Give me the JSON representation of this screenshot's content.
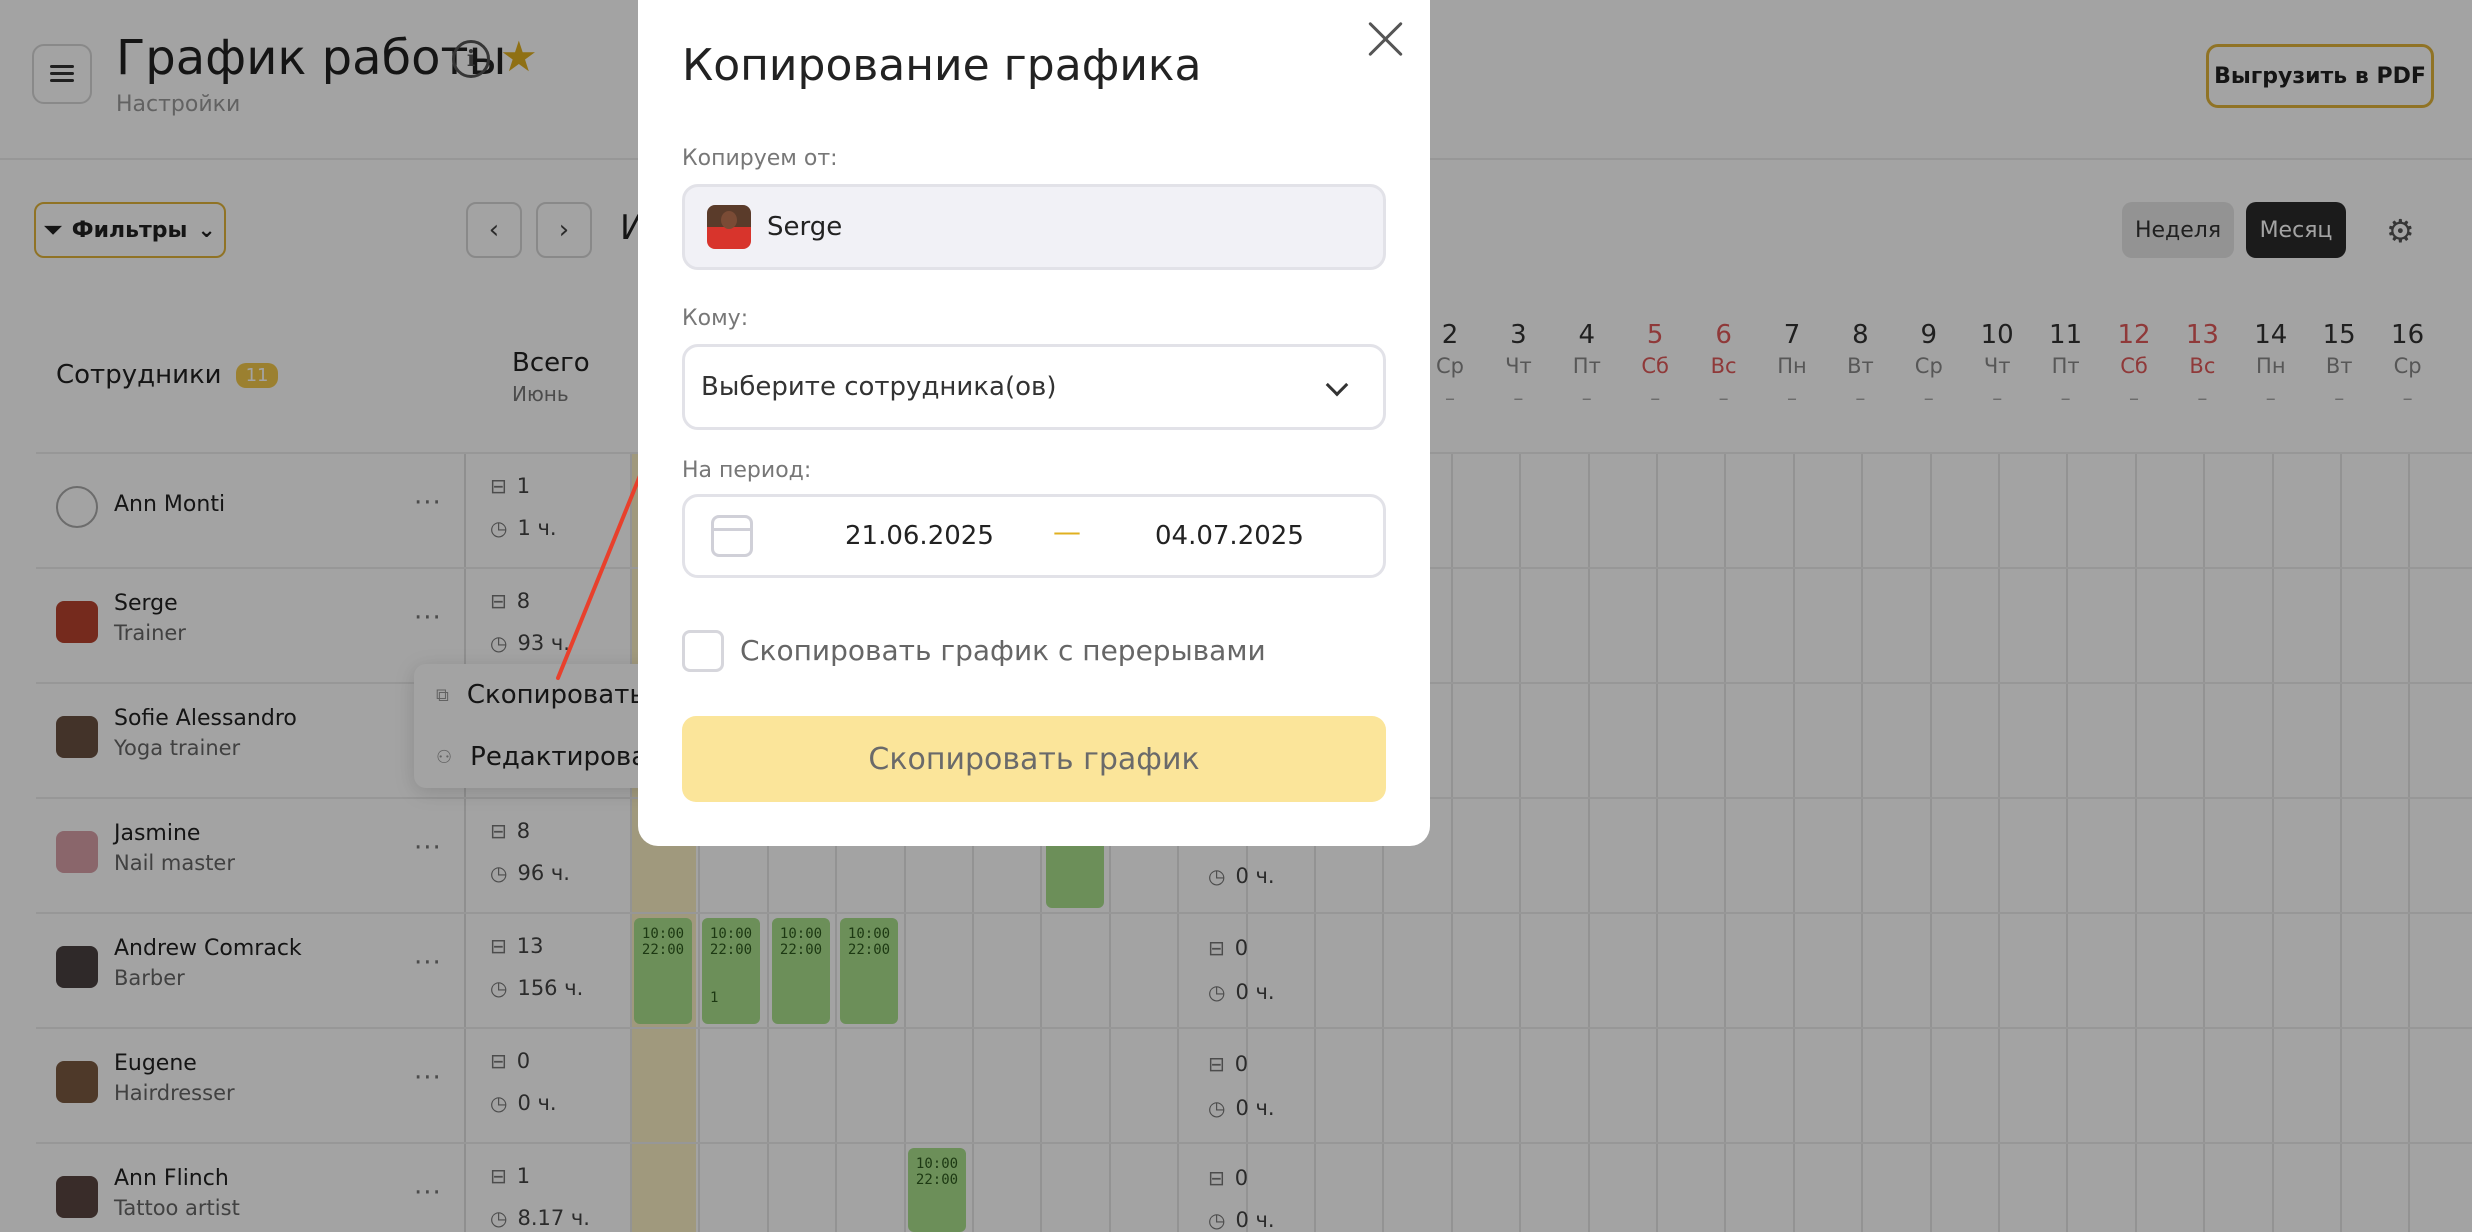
{
  "app": {
    "title": "График работы",
    "subtitle": "Настройки",
    "pdf_button": "Выгрузить в PDF",
    "filters_button": "Фильтры",
    "period_label": "И",
    "week_button": "Неделя",
    "month_button": "Месяц",
    "employees_header": "Сотрудники",
    "employees_count": "11",
    "total_header": "Всего",
    "total_month": "Июнь",
    "dash": "–"
  },
  "days": [
    {
      "n": "2",
      "w": "Ср",
      "weekend": false
    },
    {
      "n": "3",
      "w": "Чт",
      "weekend": false
    },
    {
      "n": "4",
      "w": "Пт",
      "weekend": false
    },
    {
      "n": "5",
      "w": "Сб",
      "weekend": true
    },
    {
      "n": "6",
      "w": "Вс",
      "weekend": true
    },
    {
      "n": "7",
      "w": "Пн",
      "weekend": false
    },
    {
      "n": "8",
      "w": "Вт",
      "weekend": false
    },
    {
      "n": "9",
      "w": "Ср",
      "weekend": false
    },
    {
      "n": "10",
      "w": "Чт",
      "weekend": false
    },
    {
      "n": "11",
      "w": "Пт",
      "weekend": false
    },
    {
      "n": "12",
      "w": "Сб",
      "weekend": true
    },
    {
      "n": "13",
      "w": "Вс",
      "weekend": true
    },
    {
      "n": "14",
      "w": "Пн",
      "weekend": false
    },
    {
      "n": "15",
      "w": "Вт",
      "weekend": false
    },
    {
      "n": "16",
      "w": "Ср",
      "weekend": false
    }
  ],
  "employees": [
    {
      "name": "Ann Monti",
      "role": "",
      "shifts": "1",
      "hours": "1 ч."
    },
    {
      "name": "Serge",
      "role": "Trainer",
      "shifts": "8",
      "hours": "93 ч."
    },
    {
      "name": "Sofie Alessandro",
      "role": "Yoga trainer",
      "shifts": "",
      "hours": ""
    },
    {
      "name": "Jasmine",
      "role": "Nail master",
      "shifts": "8",
      "hours": "96 ч."
    },
    {
      "name": "Andrew Comrack",
      "role": "Barber",
      "shifts": "13",
      "hours": "156 ч."
    },
    {
      "name": "Eugene",
      "role": "Hairdresser",
      "shifts": "0",
      "hours": "0 ч."
    },
    {
      "name": "Ann Flinch",
      "role": "Tattoo artist",
      "shifts": "1",
      "hours": "8.17 ч."
    }
  ],
  "right_stats": {
    "jasmine_hours": "0 ч.",
    "andrew_shifts": "0",
    "andrew_hours": "0 ч.",
    "eugene_shifts": "0",
    "eugene_hours": "0 ч.",
    "flinch_shifts": "0",
    "flinch_hours": "0 ч."
  },
  "shift_time": {
    "start": "10:00",
    "end": "22:00",
    "badge": "1"
  },
  "context_menu": {
    "copy": "Скопировать",
    "edit": "Редактироват"
  },
  "modal": {
    "title": "Копирование графика",
    "from_label": "Копируем от:",
    "from_value": "Serge",
    "to_label": "Кому:",
    "to_placeholder": "Выберите сотрудника(ов)",
    "period_label": "На период:",
    "date_from": "21.06.2025",
    "date_separator": "—",
    "date_to": "04.07.2025",
    "checkbox_label": "Скопировать график с перерывами",
    "checkbox_checked": false,
    "submit_button": "Скопировать график"
  },
  "colors": {
    "accent": "#e2b53a",
    "submit_bg": "#fbe59a",
    "shift_green": "#a9e08b",
    "weekend_red": "#e05a5a",
    "arrow_red": "#e8402c"
  }
}
